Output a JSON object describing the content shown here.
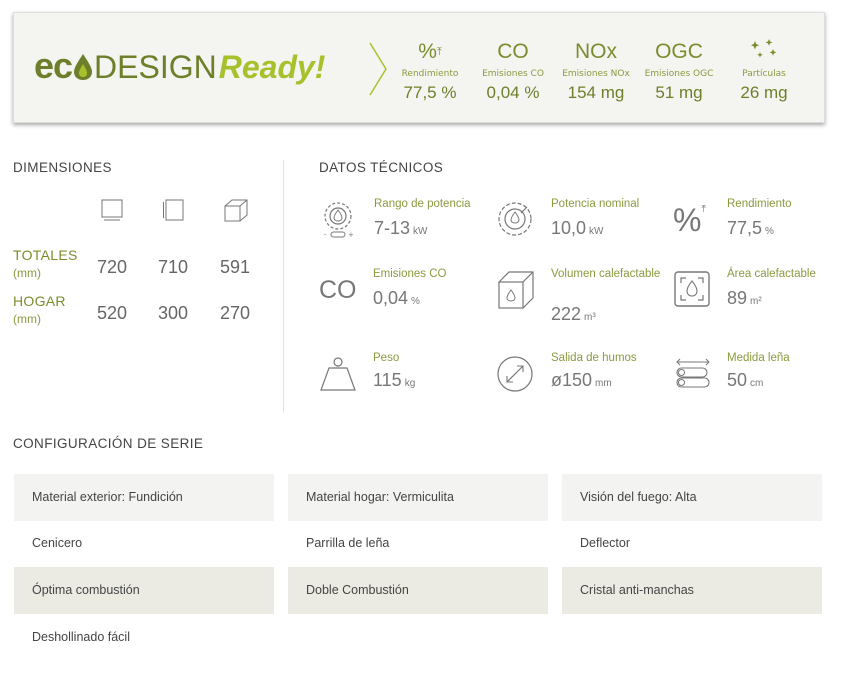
{
  "banner": {
    "logo_eco": "ec",
    "logo_design": "DESIGN",
    "logo_ready": "Ready!",
    "metrics": [
      {
        "symbol": "%",
        "label": "Rendimiento",
        "value": "77,5 %"
      },
      {
        "symbol": "CO",
        "label": "Emisiones CO",
        "value": "0,04 %"
      },
      {
        "symbol": "NOx",
        "label": "Emisiones NOx",
        "value": "154 mg"
      },
      {
        "symbol": "OGC",
        "label": "Emisiones OGC",
        "value": "51 mg"
      },
      {
        "symbol": "particles-icon",
        "label": "Partículas",
        "value": "26 mg"
      }
    ]
  },
  "dimensions": {
    "heading": "DIMENSIONES",
    "icons": [
      "width-icon",
      "height-icon",
      "depth-icon"
    ],
    "rows": [
      {
        "label": "TOTALES",
        "unit": "(mm)",
        "values": [
          "720",
          "710",
          "591"
        ]
      },
      {
        "label": "HOGAR",
        "unit": "(mm)",
        "values": [
          "520",
          "300",
          "270"
        ]
      }
    ]
  },
  "technical": {
    "heading": "DATOS TÉCNICOS",
    "items": [
      {
        "icon": "power-range-icon",
        "label": "Rango de potencia",
        "value": "7-13",
        "unit": "kW"
      },
      {
        "icon": "nominal-power-icon",
        "label": "Potencia nominal",
        "value": "10,0",
        "unit": "kW"
      },
      {
        "icon": "efficiency-icon",
        "label": "Rendimiento",
        "value": "77,5",
        "unit": "%"
      },
      {
        "icon": "co-icon",
        "label": "Emisiones CO",
        "value": "0,04",
        "unit": "%"
      },
      {
        "icon": "volume-icon",
        "label": "Volumen calefactable",
        "value": "222",
        "unit": "m³"
      },
      {
        "icon": "area-icon",
        "label": "Área calefactable",
        "value": "89",
        "unit": "m²"
      },
      {
        "icon": "weight-icon",
        "label": "Peso",
        "value": "115",
        "unit": "kg"
      },
      {
        "icon": "flue-icon",
        "label": "Salida de humos",
        "value": "ø150",
        "unit": "mm"
      },
      {
        "icon": "log-icon",
        "label": "Medida leña",
        "value": "50",
        "unit": "cm"
      }
    ]
  },
  "configuration": {
    "heading": "CONFIGURACIÓN DE SERIE",
    "items": [
      "Material exterior: Fundición",
      "Material hogar: Vermiculita",
      "Visión del fuego: Alta",
      "Cenicero",
      "Parrilla de leña",
      "Deflector",
      "Óptima combustión",
      "Doble Combustión",
      "Cristal anti-manchas",
      "Deshollinado fácil"
    ]
  },
  "colors": {
    "brand_dark": "#6d7f2a",
    "brand_light": "#a7c12d",
    "row_shade": "#ebebe3"
  }
}
